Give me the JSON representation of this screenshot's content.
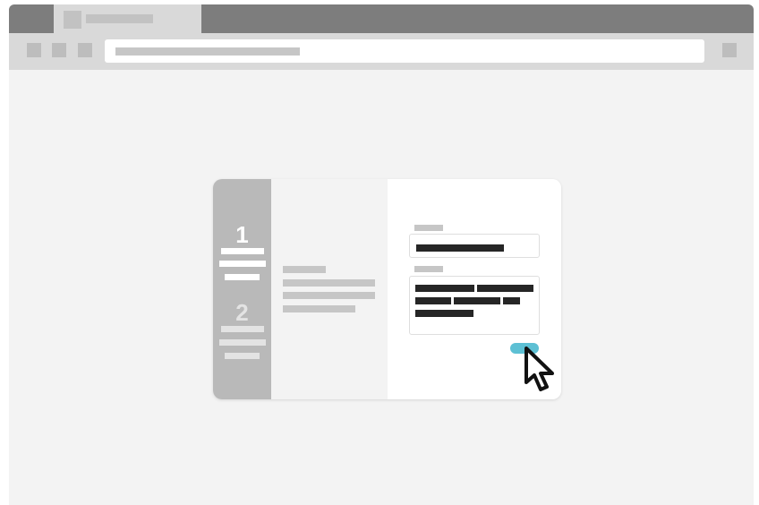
{
  "browser": {
    "tab": {
      "favicon": "page-favicon-icon",
      "title": ""
    },
    "toolbar": {
      "back": "back-icon",
      "forward": "forward-icon",
      "reload": "reload-icon",
      "address": "",
      "menu": "menu-icon"
    }
  },
  "wizard": {
    "steps": [
      {
        "number": "1",
        "state": "active"
      },
      {
        "number": "2",
        "state": "inactive"
      }
    ],
    "form": {
      "fields": [
        {
          "type": "text-input",
          "value": ""
        },
        {
          "type": "textarea",
          "value": ""
        }
      ],
      "submit_color": "#5dc0d4"
    }
  },
  "cursor": "pointer-arrow-icon",
  "colors": {
    "titlebar": "#7d7d7d",
    "toolbar": "#d9d9d9",
    "page_background": "#f3f3f3",
    "step_sidebar": "#b9b9b9",
    "accent": "#5dc0d4",
    "text_dark": "#262626"
  }
}
